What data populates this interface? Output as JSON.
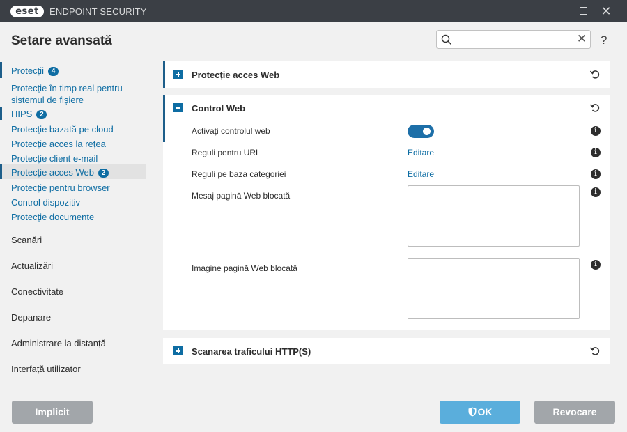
{
  "titlebar": {
    "logo": "eset",
    "app_name": "ENDPOINT SECURITY",
    "maximize_icon": "maximize-icon",
    "close_icon": "close-icon"
  },
  "header": {
    "title": "Setare avansată",
    "search_placeholder": "",
    "search_value": "",
    "help_label": "?"
  },
  "sidebar": {
    "items": [
      {
        "label": "Protecții",
        "badge": "4"
      },
      {
        "label": "Protecție în timp real pentru sistemul de fișiere"
      },
      {
        "label": "HIPS",
        "badge": "2"
      },
      {
        "label": "Protecție bazată pe cloud"
      },
      {
        "label": "Protecție acces la rețea"
      },
      {
        "label": "Protecție client e-mail"
      },
      {
        "label": "Protecție acces Web",
        "badge": "2",
        "selected": true
      },
      {
        "label": "Protecție pentru browser"
      },
      {
        "label": "Control dispozitiv"
      },
      {
        "label": "Protecție documente"
      }
    ],
    "sections": [
      "Scanări",
      "Actualizări",
      "Conectivitate",
      "Depanare",
      "Administrare la distanță",
      "Interfață utilizator"
    ]
  },
  "main": {
    "web_access": {
      "title": "Protecție acces Web",
      "expanded": false
    },
    "web_control": {
      "title": "Control Web",
      "expanded": true,
      "enable_label": "Activați controlul web",
      "enable_value": true,
      "url_rules_label": "Reguli pentru URL",
      "url_rules_link": "Editare",
      "category_rules_label": "Reguli pe baza categoriei",
      "category_rules_link": "Editare",
      "blocked_message_label": "Mesaj pagină Web blocată",
      "blocked_message_value": "",
      "blocked_image_label": "Imagine pagină Web blocată",
      "blocked_image_value": ""
    },
    "https_scan": {
      "title": "Scanarea traficului HTTP(S)",
      "expanded": false
    }
  },
  "footer": {
    "default_label": "Implicit",
    "ok_label": "OK",
    "cancel_label": "Revocare"
  },
  "colors": {
    "accent": "#0e6da3",
    "titlebar": "#3b3f45",
    "ok_button": "#5aaedc",
    "gray_button": "#a2a6aa",
    "toggle_on": "#1d6fa8"
  }
}
